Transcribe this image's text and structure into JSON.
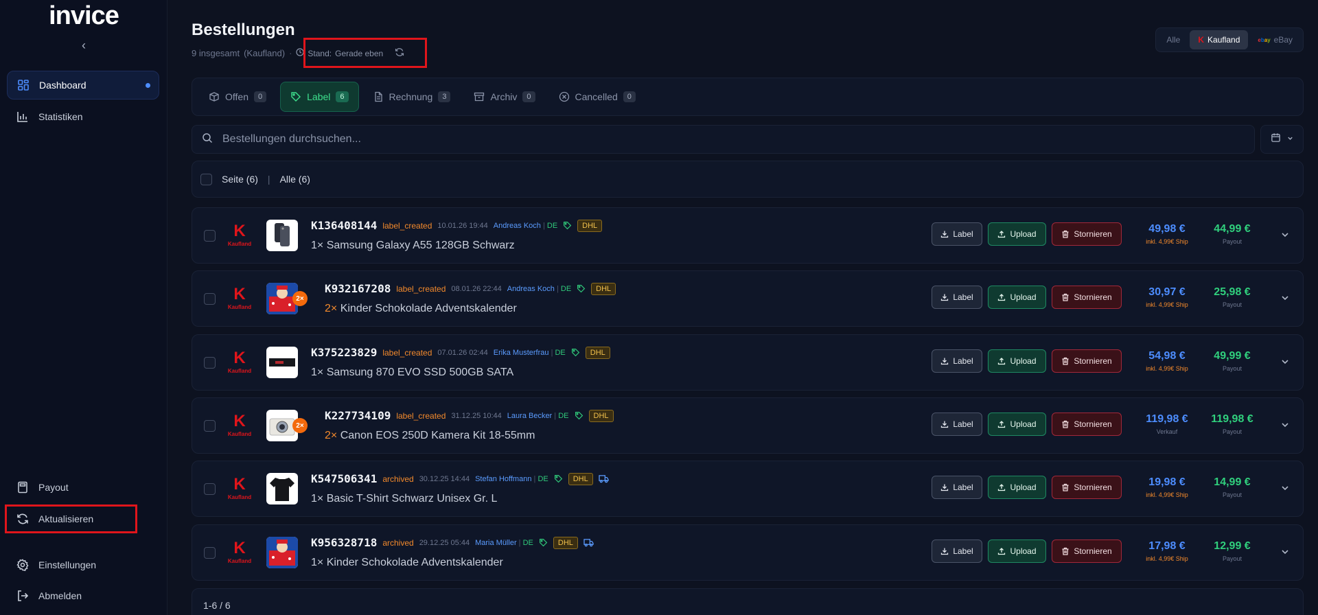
{
  "app": {
    "logo": "invice"
  },
  "sidebar": {
    "top_items": [
      {
        "label": "Dashboard",
        "icon": "dashboard-icon",
        "active": true
      },
      {
        "label": "Statistiken",
        "icon": "stats-icon",
        "active": false
      }
    ],
    "bottom_items": [
      {
        "label": "Payout",
        "icon": "calculator-icon"
      },
      {
        "label": "Aktualisieren",
        "icon": "refresh-icon"
      },
      {
        "label": "Einstellungen",
        "icon": "gear-icon"
      },
      {
        "label": "Abmelden",
        "icon": "logout-icon"
      }
    ]
  },
  "header": {
    "title": "Bestellungen",
    "total": "9 insgesamt",
    "marketplace": "(Kaufland)",
    "stand_label": "Stand:",
    "stand_value": "Gerade eben"
  },
  "platform_filter": [
    {
      "label": "Alle",
      "active": false
    },
    {
      "label": "Kaufland",
      "active": true
    },
    {
      "label": "eBay",
      "active": false
    }
  ],
  "tabs": [
    {
      "label": "Offen",
      "count": "0",
      "active": false
    },
    {
      "label": "Label",
      "count": "6",
      "active": true
    },
    {
      "label": "Rechnung",
      "count": "3",
      "active": false
    },
    {
      "label": "Archiv",
      "count": "0",
      "active": false
    },
    {
      "label": "Cancelled",
      "count": "0",
      "active": false
    }
  ],
  "search": {
    "placeholder": "Bestellungen durchsuchen..."
  },
  "selection": {
    "page": "Seite (6)",
    "all": "Alle (6)"
  },
  "buttons": {
    "label": "Label",
    "upload": "Upload",
    "storno": "Stornieren"
  },
  "orders": [
    {
      "id": "K136408144",
      "status": "label_created",
      "date": "10.01.26 19:44",
      "customer": "Andreas Koch",
      "country": "DE",
      "carrier": "DHL",
      "qty": "1×",
      "product": "Samsung Galaxy A55 128GB Schwarz",
      "price": "49,98 €",
      "price_sub": "inkl. 4,99€ Ship",
      "payout": "44,99 €",
      "payout_sub": "Payout",
      "thumb": "phone",
      "qty_badge": "",
      "truck": false
    },
    {
      "id": "K932167208",
      "status": "label_created",
      "date": "08.01.26 22:44",
      "customer": "Andreas Koch",
      "country": "DE",
      "carrier": "DHL",
      "qty": "2×",
      "product": "Kinder Schokolade Adventskalender",
      "price": "30,97 €",
      "price_sub": "inkl. 4,99€ Ship",
      "payout": "25,98 €",
      "payout_sub": "Payout",
      "thumb": "calendar",
      "qty_badge": "2×",
      "truck": false
    },
    {
      "id": "K375223829",
      "status": "label_created",
      "date": "07.01.26 02:44",
      "customer": "Erika Musterfrau",
      "country": "DE",
      "carrier": "DHL",
      "qty": "1×",
      "product": "Samsung 870 EVO SSD 500GB SATA",
      "price": "54,98 €",
      "price_sub": "inkl. 4,99€ Ship",
      "payout": "49,99 €",
      "payout_sub": "Payout",
      "thumb": "ssd",
      "qty_badge": "",
      "truck": false
    },
    {
      "id": "K227734109",
      "status": "label_created",
      "date": "31.12.25 10:44",
      "customer": "Laura Becker",
      "country": "DE",
      "carrier": "DHL",
      "qty": "2×",
      "product": "Canon EOS 250D Kamera Kit 18-55mm",
      "price": "119,98 €",
      "price_sub": "Verkauf",
      "payout": "119,98 €",
      "payout_sub": "Payout",
      "thumb": "camera",
      "qty_badge": "2×",
      "truck": false
    },
    {
      "id": "K547506341",
      "status": "archived",
      "date": "30.12.25 14:44",
      "customer": "Stefan Hoffmann",
      "country": "DE",
      "carrier": "DHL",
      "qty": "1×",
      "product": "Basic T-Shirt Schwarz Unisex Gr. L",
      "price": "19,98 €",
      "price_sub": "inkl. 4,99€ Ship",
      "payout": "14,99 €",
      "payout_sub": "Payout",
      "thumb": "shirt",
      "qty_badge": "",
      "truck": true
    },
    {
      "id": "K956328718",
      "status": "archived",
      "date": "29.12.25 05:44",
      "customer": "Maria Müller",
      "country": "DE",
      "carrier": "DHL",
      "qty": "1×",
      "product": "Kinder Schokolade Adventskalender",
      "price": "17,98 €",
      "price_sub": "inkl. 4,99€ Ship",
      "payout": "12,99 €",
      "payout_sub": "Payout",
      "thumb": "calendar",
      "qty_badge": "",
      "truck": true
    }
  ],
  "kaufland_logo": {
    "letter": "K",
    "word": "Kaufland"
  },
  "pager": {
    "text": "1-6 / 6"
  },
  "colors": {
    "accent_blue": "#4d8dff",
    "payout_green": "#30d07d",
    "status_orange": "#f48a2c",
    "highlight_red": "#e0151b"
  }
}
